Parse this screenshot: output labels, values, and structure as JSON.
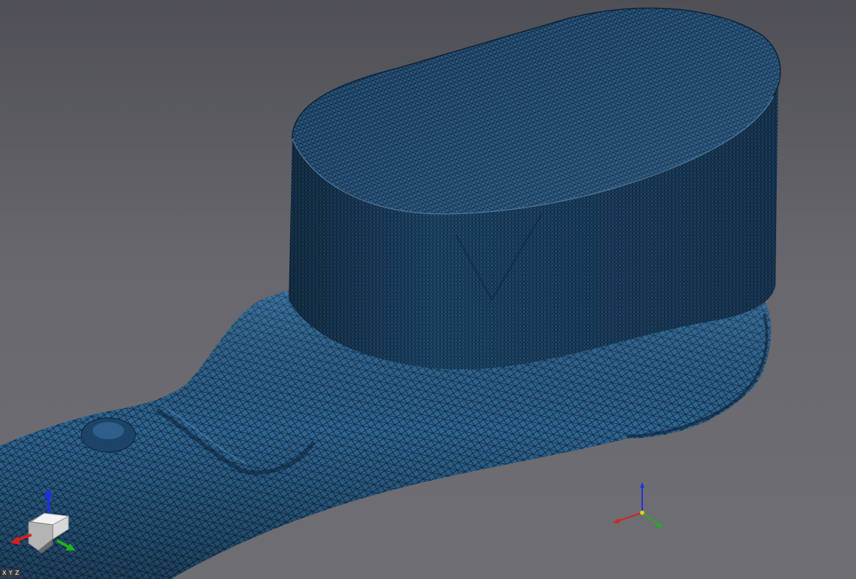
{
  "viewport": {
    "background_top": "#4f4f56",
    "background_bottom": "#6f6f73",
    "mesh_color": "#2d5f87",
    "mesh_dark_color": "#163a58",
    "mesh_edge_color": "#0a2238"
  },
  "axis_triad": {
    "x_color": "#d62020",
    "y_color": "#20b020",
    "z_color": "#2030e0",
    "origin_color": "#e0d020"
  },
  "view_cube": {
    "icon": "view-cube-icon"
  },
  "view_buttons": [
    {
      "label": "X"
    },
    {
      "label": "Y"
    },
    {
      "label": "Z"
    }
  ]
}
